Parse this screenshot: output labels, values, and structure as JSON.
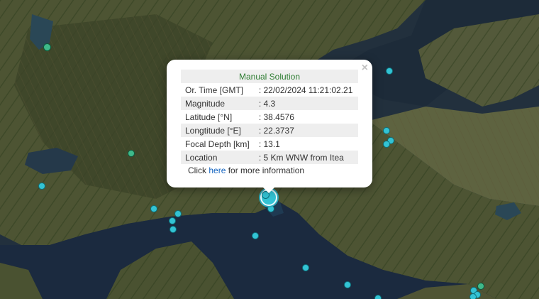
{
  "popup": {
    "title": "Manual Solution",
    "close_glyph": "×",
    "rows": [
      {
        "label": "Or. Time [GMT]",
        "value": ": 22/02/2024 11:21:02.21"
      },
      {
        "label": "Magnitude",
        "value": ": 4.3"
      },
      {
        "label": "Latitude [°N]",
        "value": ": 38.4576"
      },
      {
        "label": "Longtitude [°E]",
        "value": ": 22.3737"
      },
      {
        "label": "Focal Depth [km]",
        "value": ": 13.1"
      },
      {
        "label": "Location",
        "value": ": 5 Km WNW from Itea"
      }
    ],
    "more_prefix": "Click ",
    "more_link": "here",
    "more_suffix": " for more information"
  },
  "colors": {
    "title_green": "#2e7d32",
    "link_blue": "#1565c0",
    "quake_cyan": "#33c3d4",
    "quake_green": "#3fb98a"
  },
  "icons": {
    "close": "close-icon",
    "marker": "earthquake-marker"
  }
}
